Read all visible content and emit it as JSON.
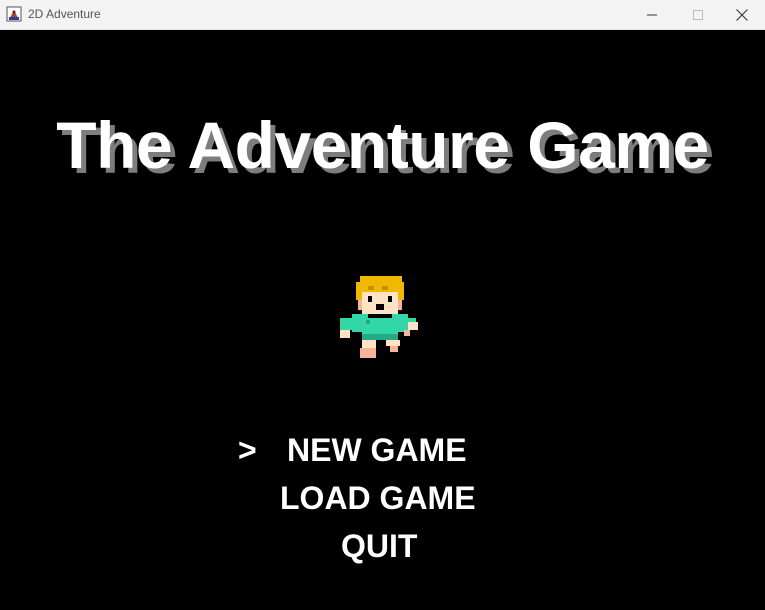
{
  "window": {
    "title": "2D Adventure",
    "icon": "java-app-icon",
    "controls": [
      "minimize-icon",
      "maximize-icon",
      "close-icon"
    ]
  },
  "game": {
    "title": "The Adventure Game",
    "title_color": "#ffffff",
    "title_shadow_color": "#7d7d7d",
    "background": "#000000",
    "sprite": "player-boy-sprite",
    "menu": {
      "cursor": ">",
      "selected_index": 0,
      "items": [
        {
          "label": "NEW GAME"
        },
        {
          "label": "LOAD GAME"
        },
        {
          "label": "QUIT"
        }
      ]
    }
  }
}
